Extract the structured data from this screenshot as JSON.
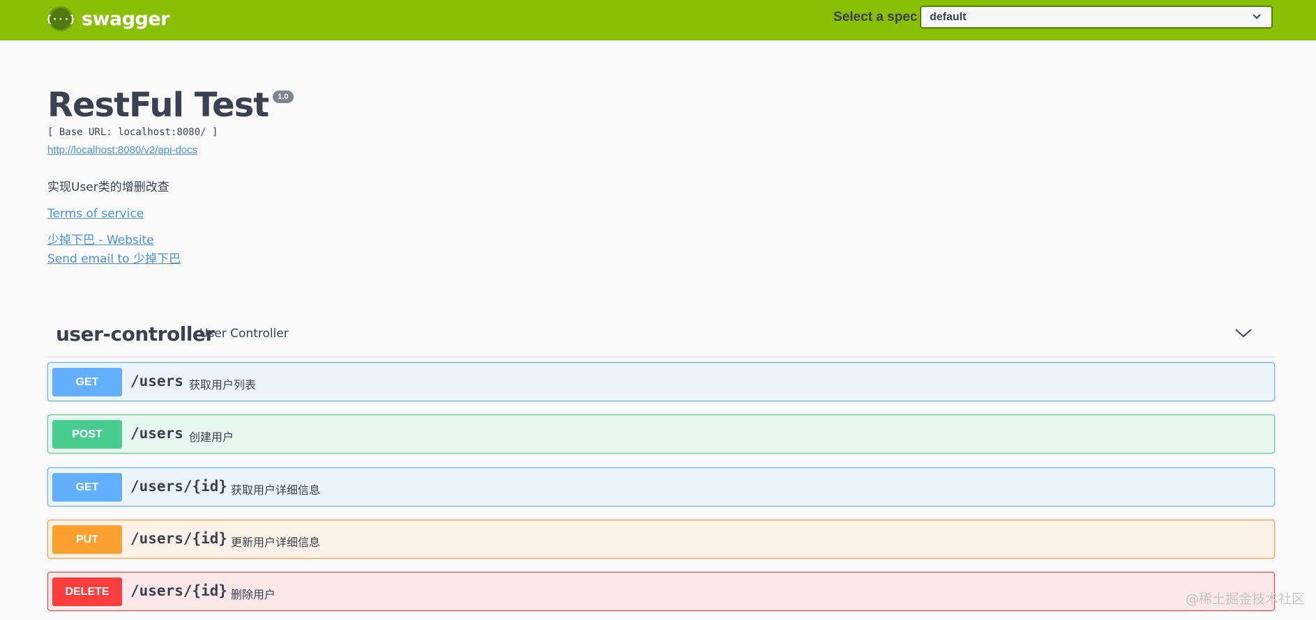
{
  "topbar": {
    "brand": "swagger",
    "spec_label": "Select a spec",
    "spec_value": "default"
  },
  "info": {
    "title": "RestFul Test",
    "version": "1.0",
    "base_url": "[ Base URL: localhost:8080/ ]",
    "api_docs_link": "http://localhost:8080/v2/api-docs",
    "description": "实现User类的增删改查",
    "terms_link": "Terms of service",
    "website_link": "少掉下巴 - Website",
    "email_link": "Send email to 少掉下巴"
  },
  "tag": {
    "name": "user-controller",
    "description": "User Controller"
  },
  "operations": [
    {
      "method": "GET",
      "path": "/users",
      "summary": "获取用户列表",
      "color": "#61affe",
      "bg": "#ebf3fb",
      "border": "#61affe"
    },
    {
      "method": "POST",
      "path": "/users",
      "summary": "创建用户",
      "color": "#49cc90",
      "bg": "#e8f6f0",
      "border": "#49cc90"
    },
    {
      "method": "GET",
      "path": "/users/{id}",
      "summary": "获取用户详细信息",
      "color": "#61affe",
      "bg": "#ebf3fb",
      "border": "#61affe"
    },
    {
      "method": "PUT",
      "path": "/users/{id}",
      "summary": "更新用户详细信息",
      "color": "#fca130",
      "bg": "#fbf1e6",
      "border": "#fca130"
    },
    {
      "method": "DELETE",
      "path": "/users/{id}",
      "summary": "删除用户",
      "color": "#f93e3e",
      "bg": "#fae7e7",
      "border": "#f93e3e"
    }
  ],
  "watermark": "@稀土掘金技术社区"
}
